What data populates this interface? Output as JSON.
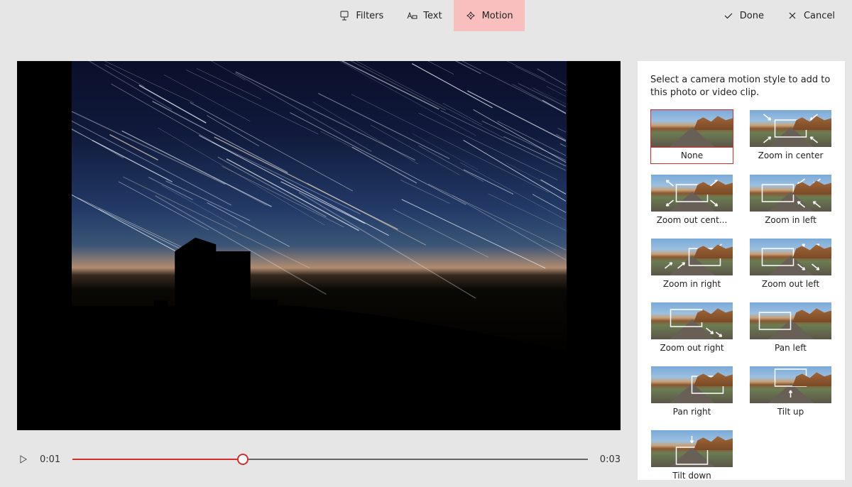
{
  "toolbar": {
    "filters_label": "Filters",
    "text_label": "Text",
    "motion_label": "Motion",
    "done_label": "Done",
    "cancel_label": "Cancel",
    "active_tab": "motion"
  },
  "player": {
    "current_time": "0:01",
    "duration": "0:03",
    "progress_pct": 33
  },
  "panel": {
    "title": "Select a camera motion style to add to this photo or video clip.",
    "selected": "none",
    "options": [
      {
        "id": "none",
        "label": "None",
        "overlay": "none"
      },
      {
        "id": "zoom_in_center",
        "label": "Zoom in center",
        "overlay": "arrows_in"
      },
      {
        "id": "zoom_out_center",
        "label": "Zoom out cent...",
        "overlay": "arrows_out"
      },
      {
        "id": "zoom_in_left",
        "label": "Zoom in left",
        "overlay": "rect_left_arrows_in"
      },
      {
        "id": "zoom_in_right",
        "label": "Zoom in right",
        "overlay": "rect_right_arrows_nw"
      },
      {
        "id": "zoom_out_left",
        "label": "Zoom out left",
        "overlay": "rect_left_arrows_out"
      },
      {
        "id": "zoom_out_right",
        "label": "Zoom out right",
        "overlay": "rect_left_arrows_se"
      },
      {
        "id": "pan_left",
        "label": "Pan left",
        "overlay": "rect_pan_left"
      },
      {
        "id": "pan_right",
        "label": "Pan right",
        "overlay": "rect_pan_right"
      },
      {
        "id": "tilt_up",
        "label": "Tilt up",
        "overlay": "rect_tilt_up"
      },
      {
        "id": "tilt_down",
        "label": "Tilt down",
        "overlay": "rect_tilt_down"
      }
    ]
  }
}
